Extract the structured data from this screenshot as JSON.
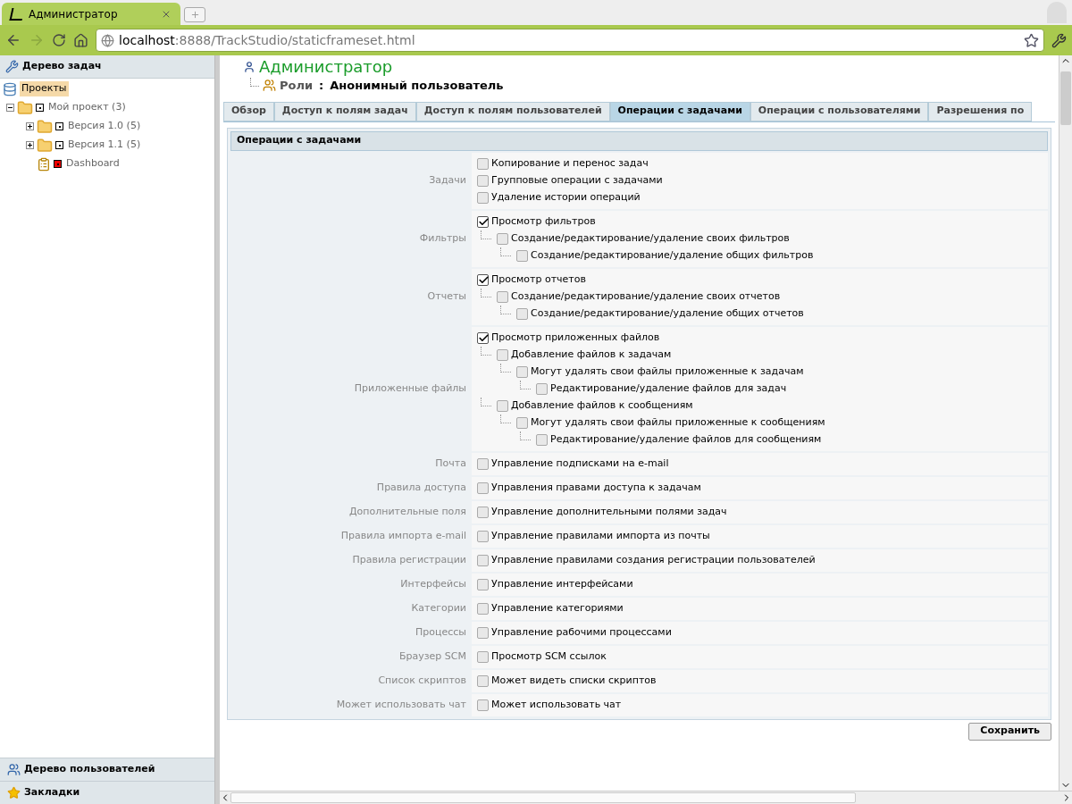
{
  "browser": {
    "tab_title": "Администратор",
    "url_host": "localhost",
    "url_rest": ":8888/TrackStudio/staticframeset.html"
  },
  "sidebar": {
    "title": "Дерево задач",
    "tree": [
      {
        "label": "Проекты",
        "kind": "root",
        "selected": true,
        "children": [
          {
            "label": "Мой проект (3)",
            "kind": "folder",
            "selected": false,
            "expanded": true,
            "children": [
              {
                "label": "Версия 1.0 (5)",
                "kind": "folder",
                "selected": false,
                "expanded": false
              },
              {
                "label": "Версия 1.1 (5)",
                "kind": "folder",
                "selected": false,
                "expanded": false
              },
              {
                "label": "Dashboard",
                "kind": "report",
                "selected": false
              }
            ]
          }
        ]
      }
    ],
    "bottom_panels": [
      {
        "label": "Дерево пользователей",
        "kind": "users"
      },
      {
        "label": "Закладки",
        "kind": "bookmarks"
      }
    ]
  },
  "header": {
    "title": "Администратор",
    "breadcrumb_label": "Роли",
    "separator": ":",
    "role": "Анонимный пользователь"
  },
  "tabs": [
    {
      "label": "Обзор",
      "selected": false
    },
    {
      "label": "Доступ к полям задач",
      "selected": false
    },
    {
      "label": "Доступ к полям пользователей",
      "selected": false
    },
    {
      "label": "Операции с задачами",
      "selected": true
    },
    {
      "label": "Операции с пользователями",
      "selected": false
    },
    {
      "label": "Разрешения по",
      "selected": false
    }
  ],
  "section": {
    "title": "Операции с задачами",
    "groups": [
      {
        "label": "Задачи",
        "items": [
          {
            "label": "Копирование и перенос задач",
            "checked": false
          },
          {
            "label": "Групповые операции с задачами",
            "checked": false
          },
          {
            "label": "Удаление истории операций",
            "checked": false
          }
        ]
      },
      {
        "label": "Фильтры",
        "items": [
          {
            "label": "Просмотр фильтров",
            "checked": true,
            "children": [
              {
                "label": "Создание/редактирование/удаление своих фильтров",
                "checked": false,
                "children": [
                  {
                    "label": "Создание/редактирование/удаление общих фильтров",
                    "checked": false
                  }
                ]
              }
            ]
          }
        ]
      },
      {
        "label": "Отчеты",
        "items": [
          {
            "label": "Просмотр отчетов",
            "checked": true,
            "children": [
              {
                "label": "Создание/редактирование/удаление своих отчетов",
                "checked": false,
                "children": [
                  {
                    "label": "Создание/редактирование/удаление общих отчетов",
                    "checked": false
                  }
                ]
              }
            ]
          }
        ]
      },
      {
        "label": "Приложенные файлы",
        "items": [
          {
            "label": "Просмотр приложенных файлов",
            "checked": true,
            "children": [
              {
                "label": "Добавление файлов к задачам",
                "checked": false,
                "children": [
                  {
                    "label": "Могут удалять свои файлы приложенные к задачам",
                    "checked": false,
                    "children": [
                      {
                        "label": "Редактирование/удаление файлов для задач",
                        "checked": false
                      }
                    ]
                  }
                ]
              },
              {
                "label": "Добавление файлов к сообщениям",
                "checked": false,
                "children": [
                  {
                    "label": "Могут удалять свои файлы приложенные к сообщениям",
                    "checked": false,
                    "children": [
                      {
                        "label": "Редактирование/удаление файлов для сообщениям",
                        "checked": false
                      }
                    ]
                  }
                ]
              }
            ]
          }
        ]
      },
      {
        "label": "Почта",
        "items": [
          {
            "label": "Управление подписками на e-mail",
            "checked": false
          }
        ]
      },
      {
        "label": "Правила доступа",
        "items": [
          {
            "label": "Управления правами доступа к задачам",
            "checked": false
          }
        ]
      },
      {
        "label": "Дополнительные поля",
        "items": [
          {
            "label": "Управление дополнительными полями задач",
            "checked": false
          }
        ]
      },
      {
        "label": "Правила импорта e-mail",
        "items": [
          {
            "label": "Управление правилами импорта из почты",
            "checked": false
          }
        ]
      },
      {
        "label": "Правила регистрации",
        "items": [
          {
            "label": "Управление правилами создания регистрации пользователей",
            "checked": false
          }
        ]
      },
      {
        "label": "Интерфейсы",
        "items": [
          {
            "label": "Управление интерфейсами",
            "checked": false
          }
        ]
      },
      {
        "label": "Категории",
        "items": [
          {
            "label": "Управление категориями",
            "checked": false
          }
        ]
      },
      {
        "label": "Процессы",
        "items": [
          {
            "label": "Управление рабочими процессами",
            "checked": false
          }
        ]
      },
      {
        "label": "Браузер SCM",
        "items": [
          {
            "label": "Просмотр SCM ссылок",
            "checked": false
          }
        ]
      },
      {
        "label": "Список скриптов",
        "items": [
          {
            "label": "Может видеть списки скриптов",
            "checked": false
          }
        ]
      },
      {
        "label": "Может использовать чат",
        "items": [
          {
            "label": "Может использовать чат",
            "checked": false
          }
        ]
      }
    ]
  },
  "save_button": "Сохранить"
}
